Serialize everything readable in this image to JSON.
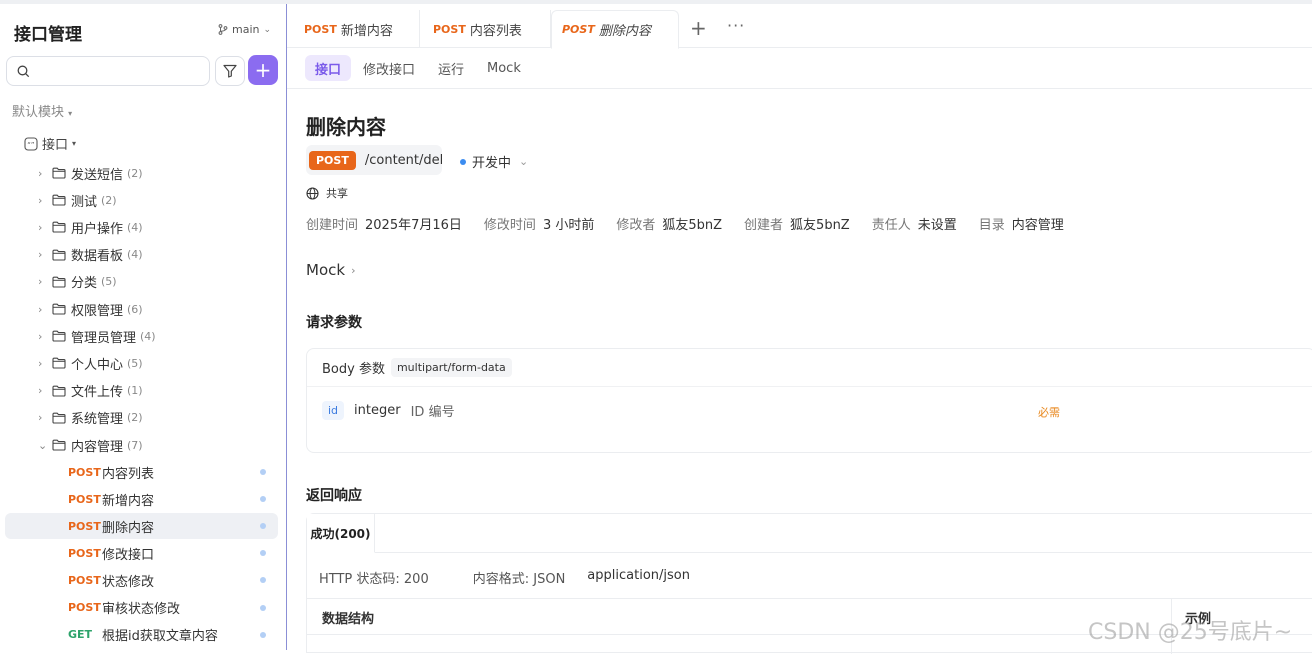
{
  "sidebar": {
    "title": "接口管理",
    "branch": "main",
    "module": "默认模块",
    "root": "接口",
    "folders": [
      {
        "name": "发送短信",
        "count": "(2)"
      },
      {
        "name": "测试",
        "count": "(2)"
      },
      {
        "name": "用户操作",
        "count": "(4)"
      },
      {
        "name": "数据看板",
        "count": "(4)"
      },
      {
        "name": "分类",
        "count": "(5)"
      },
      {
        "name": "权限管理",
        "count": "(6)"
      },
      {
        "name": "管理员管理",
        "count": "(4)"
      },
      {
        "name": "个人中心",
        "count": "(5)"
      },
      {
        "name": "文件上传",
        "count": "(1)"
      },
      {
        "name": "系统管理",
        "count": "(2)"
      },
      {
        "name": "内容管理",
        "count": "(7)"
      }
    ],
    "apis": [
      {
        "method": "POST",
        "name": "内容列表"
      },
      {
        "method": "POST",
        "name": "新增内容"
      },
      {
        "method": "POST",
        "name": "删除内容"
      },
      {
        "method": "POST",
        "name": "修改接口"
      },
      {
        "method": "POST",
        "name": "状态修改"
      },
      {
        "method": "POST",
        "name": "审核状态修改"
      },
      {
        "method": "GET",
        "name": "根据id获取文章内容"
      }
    ]
  },
  "tabs": [
    {
      "method": "POST",
      "label": "新增内容"
    },
    {
      "method": "POST",
      "label": "内容列表"
    },
    {
      "method": "POST",
      "label": "删除内容"
    }
  ],
  "subtabs": [
    "接口",
    "修改接口",
    "运行",
    "Mock"
  ],
  "api": {
    "title": "删除内容",
    "method": "POST",
    "path": "/content/del",
    "status": "开发中",
    "share": "共享",
    "meta": [
      {
        "k": "创建时间",
        "v": "2025年7月16日"
      },
      {
        "k": "修改时间",
        "v": "3 小时前"
      },
      {
        "k": "修改者",
        "v": "狐友5bnZ"
      },
      {
        "k": "创建者",
        "v": "狐友5bnZ"
      },
      {
        "k": "责任人",
        "v": "未设置"
      },
      {
        "k": "目录",
        "v": "内容管理"
      }
    ],
    "mock": "Mock"
  },
  "request": {
    "title": "请求参数",
    "body_label": "Body 参数",
    "content_type": "multipart/form-data",
    "param_name": "id",
    "param_type": "integer",
    "param_desc": "ID 编号",
    "param_required": "必需"
  },
  "response": {
    "title": "返回响应",
    "tab": "成功(200)",
    "http_status": "HTTP 状态码: 200",
    "format": "内容格式: JSON",
    "content_type": "application/json",
    "schema_title": "数据结构",
    "example_title": "示例"
  },
  "watermark": "CSDN @25号底片~",
  "colors": {
    "accent": "#8b6cf0",
    "post": "#e8661a",
    "get": "#2ea36b",
    "status_dot": "#3b8cf0"
  }
}
